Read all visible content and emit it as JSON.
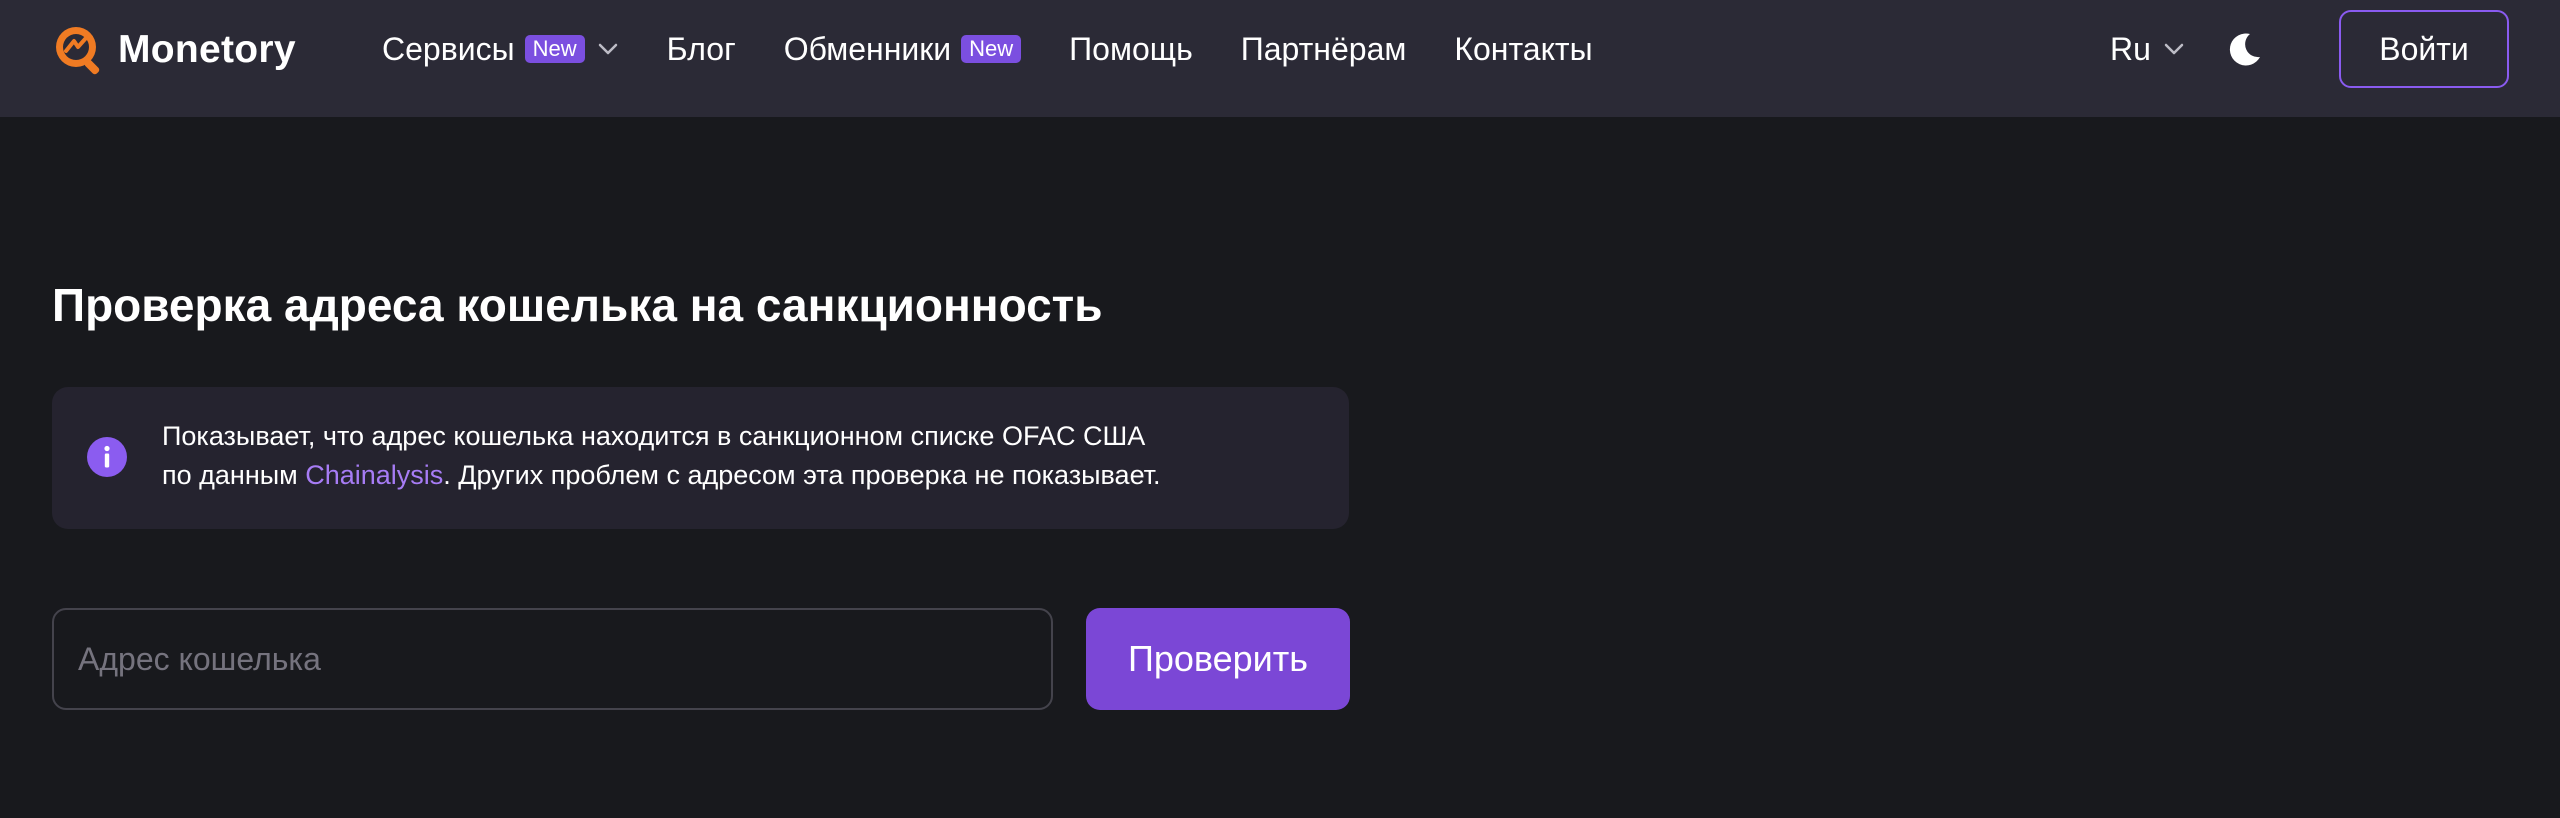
{
  "header": {
    "brand": "Monetory",
    "nav": [
      {
        "label": "Сервисы",
        "badge": "New",
        "dropdown": true
      },
      {
        "label": "Блог"
      },
      {
        "label": "Обменники",
        "badge": "New"
      },
      {
        "label": "Помощь"
      },
      {
        "label": "Партнёрам"
      },
      {
        "label": "Контакты"
      }
    ],
    "language": "Ru",
    "theme_icon": "moon-icon",
    "login_label": "Войти"
  },
  "main": {
    "title": "Проверка адреса кошелька на санкционность",
    "info": {
      "icon": "info-icon",
      "text_line1": "Показывает, что адрес кошелька находится в санкционном списке OFAC США",
      "text_line2_prefix": "по данным ",
      "link_label": "Chainalysis",
      "text_line2_suffix": ". Других проблем с адресом эта проверка не показывает."
    },
    "address_input": {
      "placeholder": "Адрес кошелька",
      "value": ""
    },
    "check_label": "Проверить"
  },
  "colors": {
    "background": "#18191d",
    "header": "#2b2a36",
    "accent": "#7b47d6",
    "badge": "#7b4fe0",
    "link": "#a77cf5",
    "info_box": "#25232f"
  }
}
